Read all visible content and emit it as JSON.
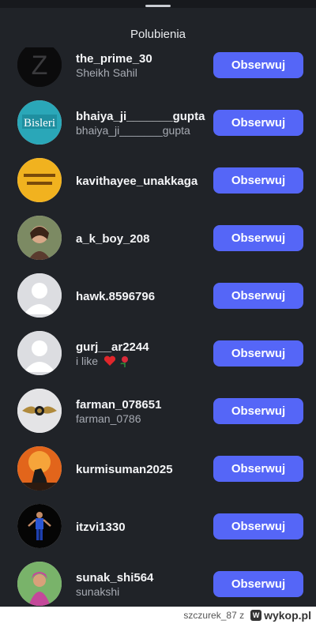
{
  "header": {
    "title": "Polubienia"
  },
  "follow_label": "Obserwuj",
  "users": [
    {
      "username": "the_prime_30",
      "subtitle": "Sheikh Sahil",
      "avatar": "letter-z-avatar"
    },
    {
      "username": "bhaiya_ji_______gupta",
      "subtitle": "bhaiya_ji_______gupta",
      "avatar": "bisleri-avatar"
    },
    {
      "username": "kavithayee_unakkaga",
      "subtitle": "",
      "avatar": "yellow-text-avatar"
    },
    {
      "username": "a_k_boy_208",
      "subtitle": "",
      "avatar": "photo-avatar"
    },
    {
      "username": "hawk.8596796",
      "subtitle": "",
      "avatar": "default-avatar"
    },
    {
      "username": "gurj__ar2244",
      "subtitle": "i like",
      "avatar": "default-avatar"
    },
    {
      "username": "farman_078651",
      "subtitle": "farman_0786",
      "avatar": "car-logo-avatar"
    },
    {
      "username": "kurmisuman2025",
      "subtitle": "",
      "avatar": "sunset-avatar"
    },
    {
      "username": "itzvi1330",
      "subtitle": "",
      "avatar": "person-avatar"
    },
    {
      "username": "sunak_shi564",
      "subtitle": "sunakshi",
      "avatar": "portrait-avatar"
    }
  ],
  "footer": {
    "credit": "szczurek_87 z",
    "brand": "wykop.pl",
    "brand_icon": "W"
  },
  "colors": {
    "background": "#202328",
    "button": "#5566f7",
    "text": "#f4f5f7",
    "subtext": "#a7abb3"
  }
}
